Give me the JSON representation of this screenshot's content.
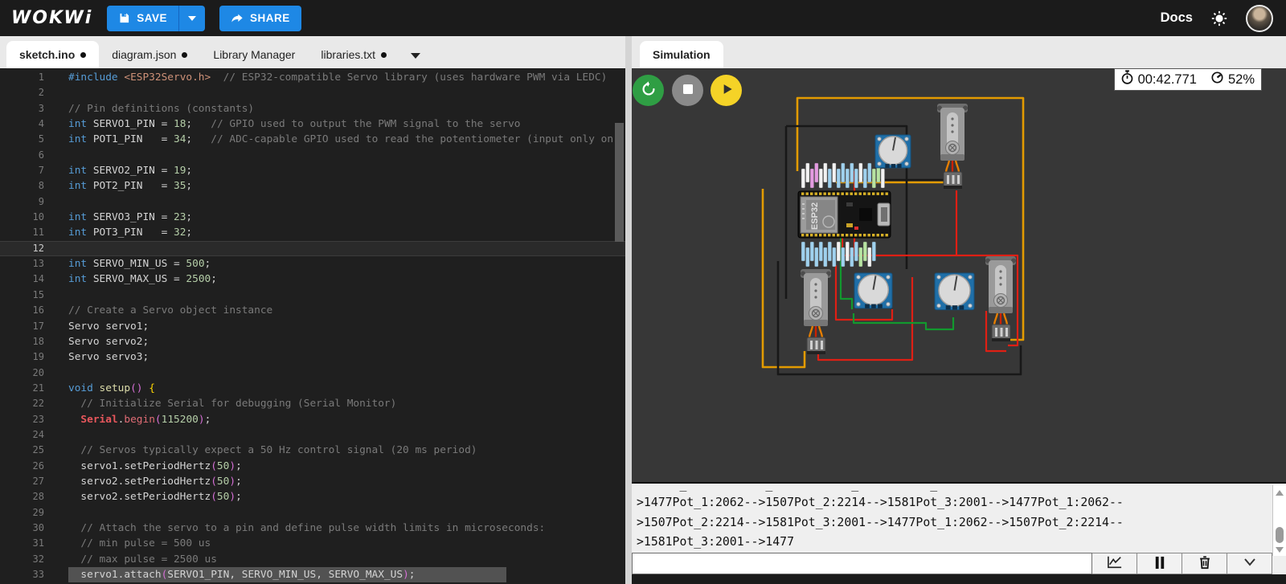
{
  "topbar": {
    "logo": "WOKWi",
    "save_label": "SAVE",
    "share_label": "SHARE",
    "docs_label": "Docs"
  },
  "tabs": {
    "left": [
      {
        "label": "sketch.ino",
        "dirty": true,
        "active": true
      },
      {
        "label": "diagram.json",
        "dirty": true,
        "active": false
      },
      {
        "label": "Library Manager",
        "dirty": false,
        "active": false
      },
      {
        "label": "libraries.txt",
        "dirty": true,
        "active": false
      }
    ]
  },
  "sim": {
    "tab_label": "Simulation",
    "timer": "00:42.771",
    "cpu": "52%"
  },
  "circuit": {
    "board_label": "ESP32",
    "components": [
      "esp32-devkit",
      "potentiometer-1",
      "potentiometer-2",
      "potentiometer-3",
      "servo-1",
      "servo-2",
      "servo-3"
    ],
    "wire_colors": {
      "orange": "#e39b00",
      "red": "#df1f14",
      "green": "#12992e",
      "black": "#181818"
    },
    "pin_tags_top": [
      "w",
      "w",
      "m",
      "m",
      "w",
      "w",
      "b",
      "w",
      "b",
      "b",
      "b",
      "b",
      "b",
      "w",
      "b",
      "b",
      "g",
      "g",
      "w"
    ],
    "pin_tags_bottom": [
      "b",
      "b",
      "b",
      "b",
      "b",
      "b",
      "b",
      "b",
      "w",
      "b",
      "w",
      "b",
      "b",
      "g",
      "g",
      "w",
      "b"
    ]
  },
  "editor": {
    "lines": [
      {
        "n": 1,
        "t": [
          [
            "k",
            "#include"
          ],
          [
            "p",
            " "
          ],
          [
            "s",
            "<ESP32Servo.h>"
          ],
          [
            "c",
            "  // ESP32-compatible Servo library (uses hardware PWM via LEDC)"
          ]
        ]
      },
      {
        "n": 2,
        "t": []
      },
      {
        "n": 3,
        "t": [
          [
            "c",
            "// Pin definitions (constants)"
          ]
        ]
      },
      {
        "n": 4,
        "t": [
          [
            "k",
            "int"
          ],
          [
            "p",
            " SERVO1_PIN = "
          ],
          [
            "n",
            "18"
          ],
          [
            "p",
            ";"
          ],
          [
            "c",
            "   // GPIO used to output the PWM signal to the servo"
          ]
        ]
      },
      {
        "n": 5,
        "t": [
          [
            "k",
            "int"
          ],
          [
            "p",
            " POT1_PIN   = "
          ],
          [
            "n",
            "34"
          ],
          [
            "p",
            ";"
          ],
          [
            "c",
            "   // ADC-capable GPIO used to read the potentiometer (input only on"
          ]
        ]
      },
      {
        "n": 6,
        "t": []
      },
      {
        "n": 7,
        "t": [
          [
            "k",
            "int"
          ],
          [
            "p",
            " SERVO2_PIN = "
          ],
          [
            "n",
            "19"
          ],
          [
            "p",
            ";"
          ]
        ]
      },
      {
        "n": 8,
        "t": [
          [
            "k",
            "int"
          ],
          [
            "p",
            " POT2_PIN   = "
          ],
          [
            "n",
            "35"
          ],
          [
            "p",
            ";"
          ]
        ]
      },
      {
        "n": 9,
        "t": []
      },
      {
        "n": 10,
        "t": [
          [
            "k",
            "int"
          ],
          [
            "p",
            " SERVO3_PIN = "
          ],
          [
            "n",
            "23"
          ],
          [
            "p",
            ";"
          ]
        ]
      },
      {
        "n": 11,
        "t": [
          [
            "k",
            "int"
          ],
          [
            "p",
            " POT3_PIN   = "
          ],
          [
            "n",
            "32"
          ],
          [
            "p",
            ";"
          ]
        ]
      },
      {
        "n": 12,
        "t": [],
        "cur": true
      },
      {
        "n": 13,
        "t": [
          [
            "k",
            "int"
          ],
          [
            "p",
            " SERVO_MIN_US = "
          ],
          [
            "n",
            "500"
          ],
          [
            "p",
            ";"
          ]
        ]
      },
      {
        "n": 14,
        "t": [
          [
            "k",
            "int"
          ],
          [
            "p",
            " SERVO_MAX_US = "
          ],
          [
            "n",
            "2500"
          ],
          [
            "p",
            ";"
          ]
        ]
      },
      {
        "n": 15,
        "t": []
      },
      {
        "n": 16,
        "t": [
          [
            "c",
            "// Create a Servo object instance"
          ]
        ]
      },
      {
        "n": 17,
        "t": [
          [
            "p",
            "Servo servo1;"
          ]
        ]
      },
      {
        "n": 18,
        "t": [
          [
            "p",
            "Servo servo2;"
          ]
        ]
      },
      {
        "n": 19,
        "t": [
          [
            "p",
            "Servo servo3;"
          ]
        ]
      },
      {
        "n": 20,
        "t": []
      },
      {
        "n": 21,
        "t": [
          [
            "k",
            "void"
          ],
          [
            "p",
            " "
          ],
          [
            "f",
            "setup"
          ],
          [
            "b2",
            "()"
          ],
          [
            "p",
            " "
          ],
          [
            "b1",
            "{"
          ]
        ]
      },
      {
        "n": 22,
        "t": [
          [
            "c",
            "  // Initialize Serial for debugging (Serial Monitor)"
          ]
        ]
      },
      {
        "n": 23,
        "t": [
          [
            "p",
            "  "
          ],
          [
            "r",
            "Serial"
          ],
          [
            "p",
            "."
          ],
          [
            "m",
            "begin"
          ],
          [
            "b2",
            "("
          ],
          [
            "n",
            "115200"
          ],
          [
            "b2",
            ")"
          ],
          [
            "p",
            ";"
          ]
        ]
      },
      {
        "n": 24,
        "t": []
      },
      {
        "n": 25,
        "t": [
          [
            "c",
            "  // Servos typically expect a 50 Hz control signal (20 ms period)"
          ]
        ]
      },
      {
        "n": 26,
        "t": [
          [
            "p",
            "  servo1.setPeriodHertz"
          ],
          [
            "b2",
            "("
          ],
          [
            "n",
            "50"
          ],
          [
            "b2",
            ")"
          ],
          [
            "p",
            ";"
          ]
        ]
      },
      {
        "n": 27,
        "t": [
          [
            "p",
            "  servo2.setPeriodHertz"
          ],
          [
            "b2",
            "("
          ],
          [
            "n",
            "50"
          ],
          [
            "b2",
            ")"
          ],
          [
            "p",
            ";"
          ]
        ]
      },
      {
        "n": 28,
        "t": [
          [
            "p",
            "  servo2.setPeriodHertz"
          ],
          [
            "b2",
            "("
          ],
          [
            "n",
            "50"
          ],
          [
            "b2",
            ")"
          ],
          [
            "p",
            ";"
          ]
        ]
      },
      {
        "n": 29,
        "t": []
      },
      {
        "n": 30,
        "t": [
          [
            "c",
            "  // Attach the servo to a pin and define pulse width limits in microseconds:"
          ]
        ]
      },
      {
        "n": 31,
        "t": [
          [
            "c",
            "  // min pulse = 500 us"
          ]
        ]
      },
      {
        "n": 32,
        "t": [
          [
            "c",
            "  // max pulse = 2500 us"
          ]
        ]
      },
      {
        "n": 33,
        "t": [
          [
            "p",
            "  servo1.attach"
          ],
          [
            "b2",
            "("
          ],
          [
            "p",
            "SERVO1_PIN, SERVO_MIN_US, SERVO_MAX_US"
          ],
          [
            "b2",
            ")"
          ],
          [
            "p",
            ";"
          ]
        ],
        "sel": true
      }
    ]
  },
  "serial": {
    "clipped_line": "      _           _           _          _",
    "lines": [
      ">1477Pot_1:2062-->1507Pot_2:2214-->1581Pot_3:2001-->1477Pot_1:2062--",
      ">1507Pot_2:2214-->1581Pot_3:2001-->1477Pot_1:2062-->1507Pot_2:2214--",
      ">1581Pot_3:2001-->1477"
    ],
    "input_value": ""
  }
}
